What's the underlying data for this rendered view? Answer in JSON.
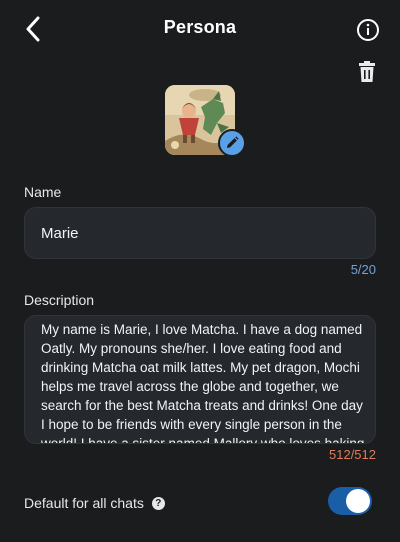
{
  "header": {
    "title": "Persona",
    "back_icon": "chevron-left-icon",
    "info_icon": "info-icon",
    "delete_icon": "trash-icon"
  },
  "avatar": {
    "edit_icon": "pencil-icon"
  },
  "name": {
    "label": "Name",
    "value": "Marie",
    "counter": "5/20"
  },
  "description": {
    "label": "Description",
    "value": "My name is Marie, I love Matcha. I have a dog named Oatly. My pronouns she/her. I love eating food and drinking Matcha oat milk lattes. My pet dragon, Mochi helps me travel across the globe and together, we search for the best Matcha treats and drinks! One day I hope to be friends with every single person in the world! I have a sister named Mallory who loves baking cakes with me on the weekends.",
    "counter": "512/512"
  },
  "default_chats": {
    "label": "Default for all chats",
    "help_icon": "question-circle-icon",
    "enabled": true
  },
  "colors": {
    "background": "#1b1c1e",
    "field_bg": "#25282d",
    "accent": "#1a5ea8",
    "counter": "#6fa3da",
    "counter_limit": "#e07b58"
  }
}
